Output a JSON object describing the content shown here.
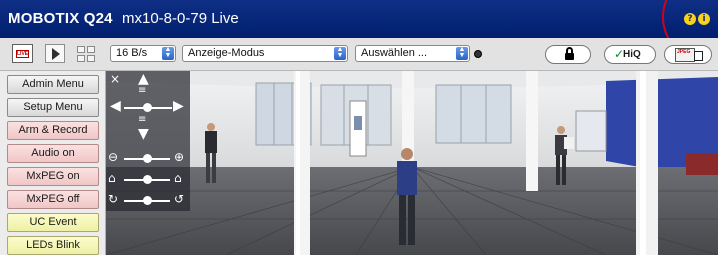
{
  "header": {
    "brand": "MOBOTIX Q24",
    "camera_name": "mx10-8-0-79 Live",
    "help_icon": "question-icon",
    "info_icon": "info-icon"
  },
  "toolbar": {
    "live_label": "LIVE",
    "frame_rate": "16 B/s",
    "display_mode": "Anzeige-Modus",
    "select": "Auswählen ...",
    "hiq_label": "HiQ",
    "jpeg_label": "JPEG"
  },
  "sidebar": {
    "items": [
      {
        "label": "Admin Menu",
        "style": "gray"
      },
      {
        "label": "Setup Menu",
        "style": "gray"
      },
      {
        "label": "Arm & Record",
        "style": "pink"
      },
      {
        "label": "Audio on",
        "style": "pink"
      },
      {
        "label": "MxPEG on",
        "style": "pink"
      },
      {
        "label": "MxPEG off",
        "style": "pink"
      },
      {
        "label": "UC Event",
        "style": "yellow"
      },
      {
        "label": "LEDs Blink",
        "style": "yellow"
      }
    ]
  },
  "ptz": {
    "close": "×",
    "zoom_slider": 0.55,
    "focus_slider": 0.55,
    "third_slider": 0.55
  },
  "colors": {
    "title_bg": "#0f2f86",
    "toolbar_bg": "#e2e2e2",
    "pink_button": "#f0c6c6",
    "yellow_button": "#eef0a4",
    "annotation_circle": "#d4001a"
  }
}
